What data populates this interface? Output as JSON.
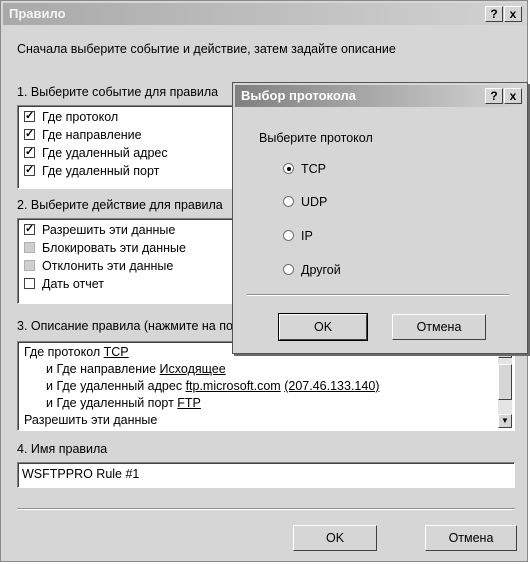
{
  "window": {
    "title": "Правило",
    "help_button": "?",
    "close_button": "x",
    "intro": "Сначала выберите событие и действие, затем задайте описание",
    "section1_label": "1. Выберите событие для правила",
    "events": [
      {
        "label": "Где протокол",
        "checked": true
      },
      {
        "label": "Где направление",
        "checked": true
      },
      {
        "label": "Где удаленный адрес",
        "checked": true
      },
      {
        "label": "Где удаленный порт",
        "checked": true
      }
    ],
    "section2_label": "2. Выберите действие для правила",
    "actions": [
      {
        "label": "Разрешить эти данные",
        "state": "checked"
      },
      {
        "label": "Блокировать эти данные",
        "state": "disabled"
      },
      {
        "label": "Отклонить эти данные",
        "state": "disabled"
      },
      {
        "label": "Дать отчет",
        "state": "unchecked"
      }
    ],
    "section3_label": "3. Описание правила (нажмите на подчеркнутое значение для изменения)",
    "description": {
      "line1_text": "Где протокол ",
      "line1_link": "TCP",
      "line2_text": "и Где направление ",
      "line2_link": "Исходящее",
      "line3_text": "и Где удаленный адрес ",
      "line3_link1": "ftp.microsoft.com",
      "line3_link2": "(207.46.133.140)",
      "line4_text": "и Где удаленный порт ",
      "line4_link": "FTP",
      "line5_text": "Разрешить эти данные"
    },
    "section4_label": "4. Имя правила",
    "rule_name_value": "WSFTPPRO Rule #1",
    "ok_label": "OK",
    "cancel_label": "Отмена"
  },
  "dialog": {
    "title": "Выбор протокола",
    "help_button": "?",
    "close_button": "x",
    "prompt": "Выберите протокол",
    "options": [
      {
        "label": "TCP",
        "selected": true
      },
      {
        "label": "UDP",
        "selected": false
      },
      {
        "label": "IP",
        "selected": false
      },
      {
        "label": "Другой",
        "selected": false
      }
    ],
    "ok_label": "OK",
    "cancel_label": "Отмена"
  }
}
